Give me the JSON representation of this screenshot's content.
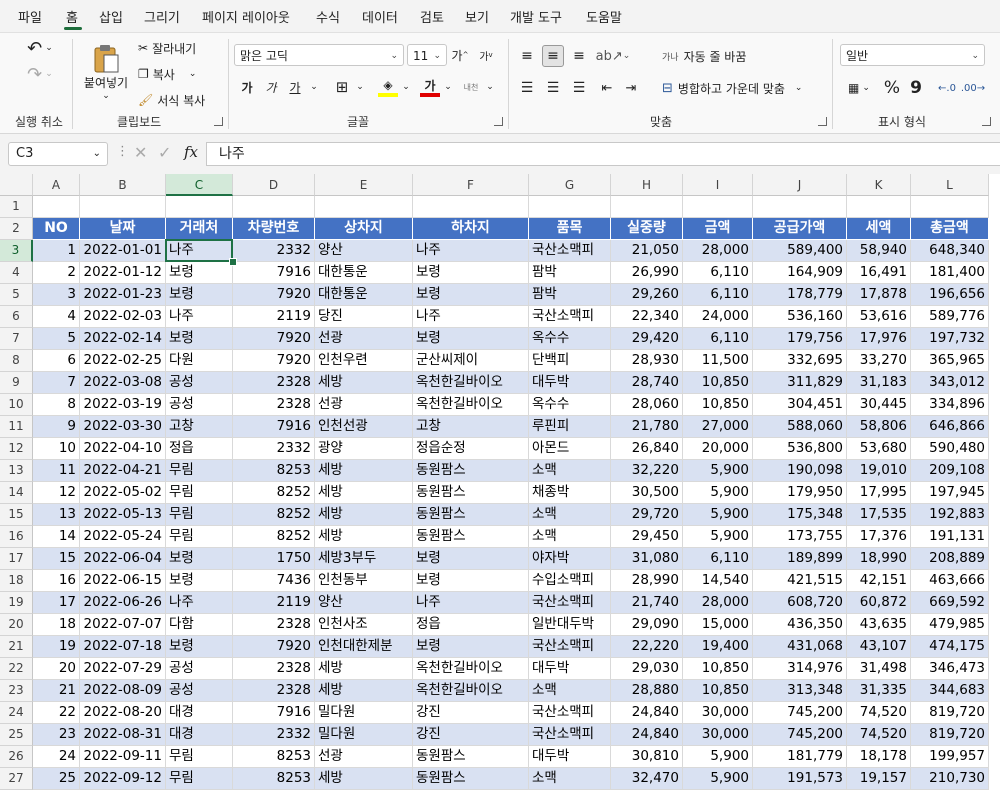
{
  "menu": [
    "파일",
    "홈",
    "삽입",
    "그리기",
    "페이지 레이아웃",
    "수식",
    "데이터",
    "검토",
    "보기",
    "개발 도구",
    "도움말"
  ],
  "ribbon": {
    "undo_group": "실행 취소",
    "clipboard_group": "클립보드",
    "paste": "붙여넣기",
    "cut": "잘라내기",
    "copy": "복사",
    "format_painter": "서식 복사",
    "font_group": "글꼴",
    "font_name": "맑은 고딕",
    "font_size": "11",
    "bold": "가",
    "italic": "가",
    "underline": "가",
    "font_color": "가",
    "phonetic": "내천",
    "align_group": "맞춤",
    "wrap_text": "자동 줄 바꿈",
    "merge_center": "병합하고 가운데 맞춤",
    "number_group": "표시 형식",
    "number_format": "일반",
    "percent": "%",
    "comma": "9"
  },
  "formula_bar": {
    "name_box": "C3",
    "fx": "fx",
    "content": "나주"
  },
  "columns": [
    "A",
    "B",
    "C",
    "D",
    "E",
    "F",
    "G",
    "H",
    "I",
    "J",
    "K",
    "L"
  ],
  "headers": [
    "NO",
    "날짜",
    "거래처",
    "차량번호",
    "상차지",
    "하차지",
    "품목",
    "실중량",
    "금액",
    "공급가액",
    "세액",
    "총금액"
  ],
  "rows": [
    [
      "1",
      "2022-01-01",
      "나주",
      "2332",
      "양산",
      "나주",
      "국산소맥피",
      "21,050",
      "28,000",
      "589,400",
      "58,940",
      "648,340"
    ],
    [
      "2",
      "2022-01-12",
      "보령",
      "7916",
      "대한통운",
      "보령",
      "팜박",
      "26,990",
      "6,110",
      "164,909",
      "16,491",
      "181,400"
    ],
    [
      "3",
      "2022-01-23",
      "보령",
      "7920",
      "대한통운",
      "보령",
      "팜박",
      "29,260",
      "6,110",
      "178,779",
      "17,878",
      "196,656"
    ],
    [
      "4",
      "2022-02-03",
      "나주",
      "2119",
      "당진",
      "나주",
      "국산소맥피",
      "22,340",
      "24,000",
      "536,160",
      "53,616",
      "589,776"
    ],
    [
      "5",
      "2022-02-14",
      "보령",
      "7920",
      "선광",
      "보령",
      "옥수수",
      "29,420",
      "6,110",
      "179,756",
      "17,976",
      "197,732"
    ],
    [
      "6",
      "2022-02-25",
      "다원",
      "7920",
      "인천우련",
      "군산씨제이",
      "단백피",
      "28,930",
      "11,500",
      "332,695",
      "33,270",
      "365,965"
    ],
    [
      "7",
      "2022-03-08",
      "공성",
      "2328",
      "세방",
      "옥천한길바이오",
      "대두박",
      "28,740",
      "10,850",
      "311,829",
      "31,183",
      "343,012"
    ],
    [
      "8",
      "2022-03-19",
      "공성",
      "2328",
      "선광",
      "옥천한길바이오",
      "옥수수",
      "28,060",
      "10,850",
      "304,451",
      "30,445",
      "334,896"
    ],
    [
      "9",
      "2022-03-30",
      "고창",
      "7916",
      "인천선광",
      "고창",
      "루핀피",
      "21,780",
      "27,000",
      "588,060",
      "58,806",
      "646,866"
    ],
    [
      "10",
      "2022-04-10",
      "정읍",
      "2332",
      "광양",
      "정읍순정",
      "아몬드",
      "26,840",
      "20,000",
      "536,800",
      "53,680",
      "590,480"
    ],
    [
      "11",
      "2022-04-21",
      "무림",
      "8253",
      "세방",
      "동원팜스",
      "소맥",
      "32,220",
      "5,900",
      "190,098",
      "19,010",
      "209,108"
    ],
    [
      "12",
      "2022-05-02",
      "무림",
      "8252",
      "세방",
      "동원팜스",
      "채종박",
      "30,500",
      "5,900",
      "179,950",
      "17,995",
      "197,945"
    ],
    [
      "13",
      "2022-05-13",
      "무림",
      "8252",
      "세방",
      "동원팜스",
      "소맥",
      "29,720",
      "5,900",
      "175,348",
      "17,535",
      "192,883"
    ],
    [
      "14",
      "2022-05-24",
      "무림",
      "8252",
      "세방",
      "동원팜스",
      "소맥",
      "29,450",
      "5,900",
      "173,755",
      "17,376",
      "191,131"
    ],
    [
      "15",
      "2022-06-04",
      "보령",
      "1750",
      "세방3부두",
      "보령",
      "야자박",
      "31,080",
      "6,110",
      "189,899",
      "18,990",
      "208,889"
    ],
    [
      "16",
      "2022-06-15",
      "보령",
      "7436",
      "인천동부",
      "보령",
      "수입소맥피",
      "28,990",
      "14,540",
      "421,515",
      "42,151",
      "463,666"
    ],
    [
      "17",
      "2022-06-26",
      "나주",
      "2119",
      "양산",
      "나주",
      "국산소맥피",
      "21,740",
      "28,000",
      "608,720",
      "60,872",
      "669,592"
    ],
    [
      "18",
      "2022-07-07",
      "다함",
      "2328",
      "인천사조",
      "정읍",
      "일반대두박",
      "29,090",
      "15,000",
      "436,350",
      "43,635",
      "479,985"
    ],
    [
      "19",
      "2022-07-18",
      "보령",
      "7920",
      "인천대한제분",
      "보령",
      "국산소맥피",
      "22,220",
      "19,400",
      "431,068",
      "43,107",
      "474,175"
    ],
    [
      "20",
      "2022-07-29",
      "공성",
      "2328",
      "세방",
      "옥천한길바이오",
      "대두박",
      "29,030",
      "10,850",
      "314,976",
      "31,498",
      "346,473"
    ],
    [
      "21",
      "2022-08-09",
      "공성",
      "2328",
      "세방",
      "옥천한길바이오",
      "소맥",
      "28,880",
      "10,850",
      "313,348",
      "31,335",
      "344,683"
    ],
    [
      "22",
      "2022-08-20",
      "대경",
      "7916",
      "밀다원",
      "강진",
      "국산소맥피",
      "24,840",
      "30,000",
      "745,200",
      "74,520",
      "819,720"
    ],
    [
      "23",
      "2022-08-31",
      "대경",
      "2332",
      "밀다원",
      "강진",
      "국산소맥피",
      "24,840",
      "30,000",
      "745,200",
      "74,520",
      "819,720"
    ],
    [
      "24",
      "2022-09-11",
      "무림",
      "8253",
      "선광",
      "동원팜스",
      "대두박",
      "30,810",
      "5,900",
      "181,779",
      "18,178",
      "199,957"
    ],
    [
      "25",
      "2022-09-12",
      "무림",
      "8253",
      "세방",
      "동원팜스",
      "소맥",
      "32,470",
      "5,900",
      "191,573",
      "19,157",
      "210,730"
    ]
  ],
  "colors": {
    "header_blue": "#4472c4",
    "band": "#d9e1f2",
    "accent_green": "#1e7145"
  }
}
